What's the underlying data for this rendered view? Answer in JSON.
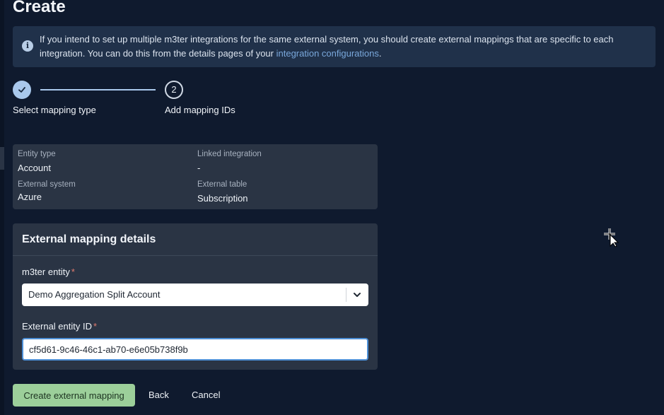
{
  "page": {
    "title": "Create"
  },
  "info_banner": {
    "icon": "info-icon",
    "text_before_link": "If you intend to set up multiple m3ter integrations for the same external system, you should create external mappings that are specific to each integration. You can do this from the details pages of your ",
    "link_text": "integration configurations",
    "text_after_link": "."
  },
  "stepper": {
    "steps": [
      {
        "label": "Select mapping type",
        "status": "complete",
        "icon": "check-icon"
      },
      {
        "label": "Add mapping IDs",
        "number": "2",
        "status": "current"
      }
    ]
  },
  "summary": {
    "entity_type_label": "Entity type",
    "entity_type_value": "Account",
    "linked_integration_label": "Linked integration",
    "linked_integration_value": "-",
    "external_system_label": "External system",
    "external_system_value": "Azure",
    "external_table_label": "External table",
    "external_table_value": "Subscription"
  },
  "details": {
    "title": "External mapping details",
    "m3ter_entity_label": "m3ter entity",
    "m3ter_entity_value": "Demo Aggregation Split Account",
    "external_entity_id_label": "External entity ID",
    "external_entity_id_value": "cf5d61-9c46-46c1-ab70-e6e05b738f9b",
    "required_marker": "*"
  },
  "actions": {
    "create_label": "Create external mapping",
    "back_label": "Back",
    "cancel_label": "Cancel"
  },
  "colors": {
    "background": "#0f1a2e",
    "banner": "#20314a",
    "link": "#7aa8dc",
    "card": "#2a3444",
    "step_accent": "#a9c8ec",
    "primary_button": "#9ccf9a",
    "required": "#e07b6e"
  }
}
